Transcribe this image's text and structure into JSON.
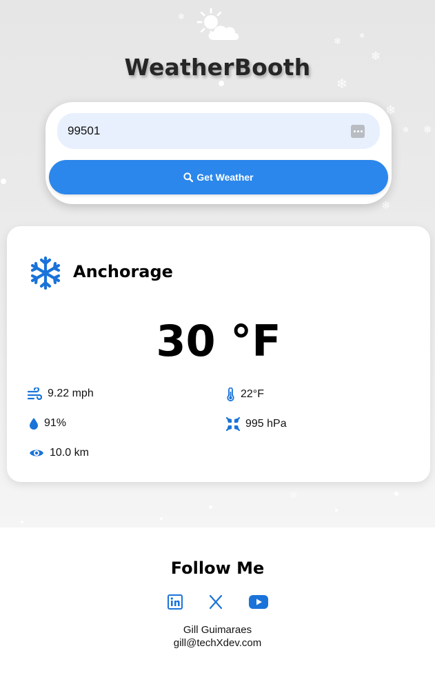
{
  "app": {
    "title": "WeatherBooth"
  },
  "icons": {
    "logo": "sun-cloud-icon",
    "search_button": "magnifier-icon",
    "condition": "snowflake-icon",
    "wind": "wind-icon",
    "feels_like": "thermometer-icon",
    "humidity": "droplet-icon",
    "pressure": "compress-icon",
    "visibility": "eye-icon"
  },
  "search": {
    "value": "99501",
    "button_label": "Get Weather"
  },
  "weather": {
    "city": "Anchorage",
    "temperature": "30 °F",
    "wind": "9.22 mph",
    "feels_like": "22°F",
    "humidity": "91%",
    "pressure": "995 hPa",
    "visibility": "10.0 km"
  },
  "footer": {
    "title": "Follow Me",
    "social": [
      "linkedin",
      "x",
      "youtube"
    ],
    "name": "Gill Guimaraes",
    "email": "gill@techXdev.com"
  },
  "colors": {
    "accent": "#2b87eb",
    "input_bg": "#e8f0fe",
    "background": "#e8e8e8",
    "card": "#ffffff",
    "icon_blue": "#1a73d9"
  }
}
